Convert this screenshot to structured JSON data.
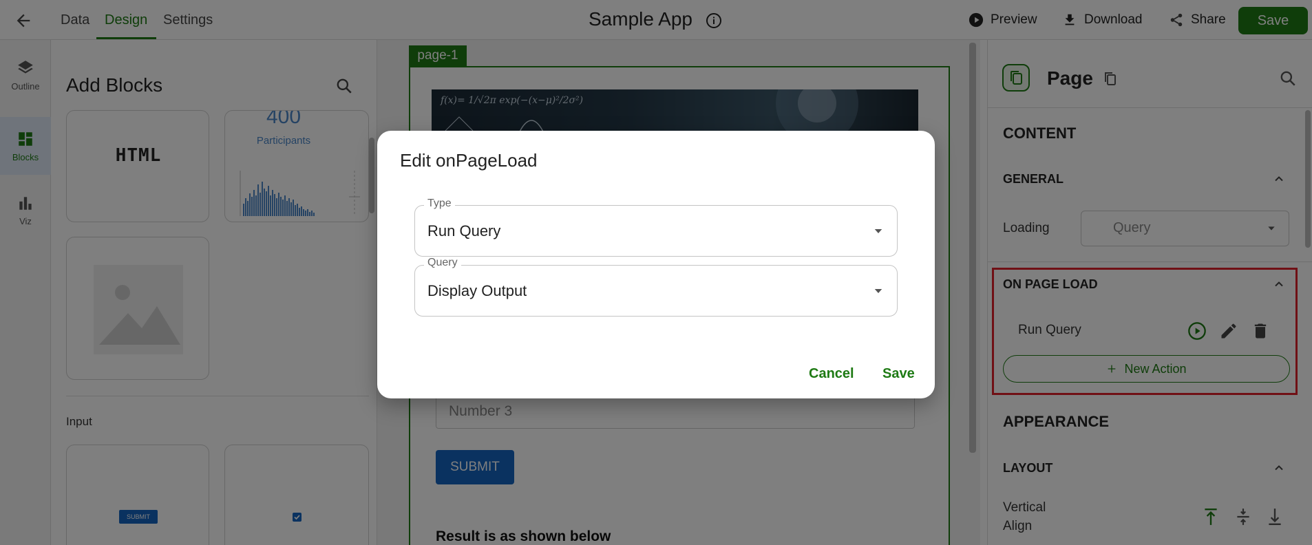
{
  "topbar": {
    "tabs": [
      {
        "label": "Data"
      },
      {
        "label": "Design"
      },
      {
        "label": "Settings"
      }
    ],
    "app_title": "Sample App",
    "preview_label": "Preview",
    "download_label": "Download",
    "share_label": "Share",
    "save_label": "Save"
  },
  "rail": {
    "items": [
      {
        "label": "Outline"
      },
      {
        "label": "Blocks"
      },
      {
        "label": "Viz"
      }
    ]
  },
  "blocks_panel": {
    "title": "Add Blocks",
    "html_card_label": "HTML",
    "participants_label": "Participants",
    "participants_count": "400",
    "section_input": "Input",
    "submit_mini": "SUBMIT"
  },
  "canvas": {
    "page_tag": "page-1",
    "number_placeholder": "Number 3",
    "submit_label": "SUBMIT",
    "result_text": "Result is as shown below"
  },
  "right_panel": {
    "title": "Page",
    "content_heading": "CONTENT",
    "general_heading": "GENERAL",
    "loading_label": "Loading",
    "loading_value": "Query",
    "on_page_load_heading": "ON PAGE LOAD",
    "action_label": "Run Query",
    "new_action_label": "New Action",
    "appearance_heading": "APPEARANCE",
    "layout_heading": "LAYOUT",
    "vertical_label_1": "Vertical",
    "vertical_label_2": "Align"
  },
  "dialog": {
    "title": "Edit onPageLoad",
    "type_label": "Type",
    "type_value": "Run Query",
    "query_label": "Query",
    "query_value": "Display Output",
    "cancel_label": "Cancel",
    "save_label": "Save"
  },
  "colors": {
    "accent": "#1e7a14",
    "highlight": "#e0202b",
    "button_blue": "#1565c0"
  }
}
